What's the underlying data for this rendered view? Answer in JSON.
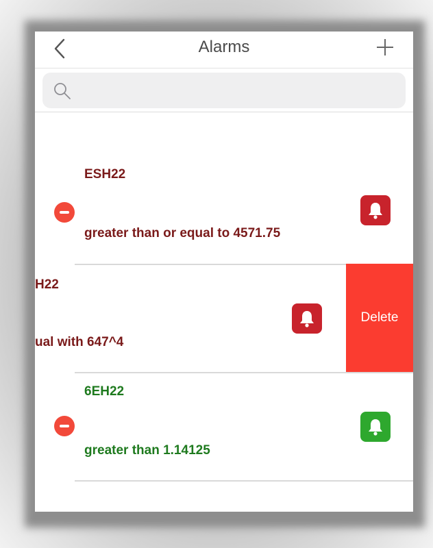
{
  "navbar": {
    "title": "Alarms",
    "back_icon": "chevron-left-icon",
    "add_icon": "plus-icon"
  },
  "search": {
    "placeholder": "",
    "value": "",
    "icon": "search-icon"
  },
  "alarms": [
    {
      "symbol": "ESH22",
      "condition": "greater than or equal to 4571.75",
      "bell_color": "#c8232c",
      "text_color": "#7a1a1a"
    },
    {
      "symbol": "H22",
      "condition": "ual with 647^4",
      "bell_color": "#c8232c",
      "text_color": "#7a1a1a",
      "swiped": true
    },
    {
      "symbol": "6EH22",
      "condition": "greater than 1.14125",
      "bell_color": "#2ea82e",
      "text_color": "#1e7a1e"
    }
  ],
  "actions": {
    "delete_label": "Delete",
    "delete_color": "#fb3c30"
  }
}
